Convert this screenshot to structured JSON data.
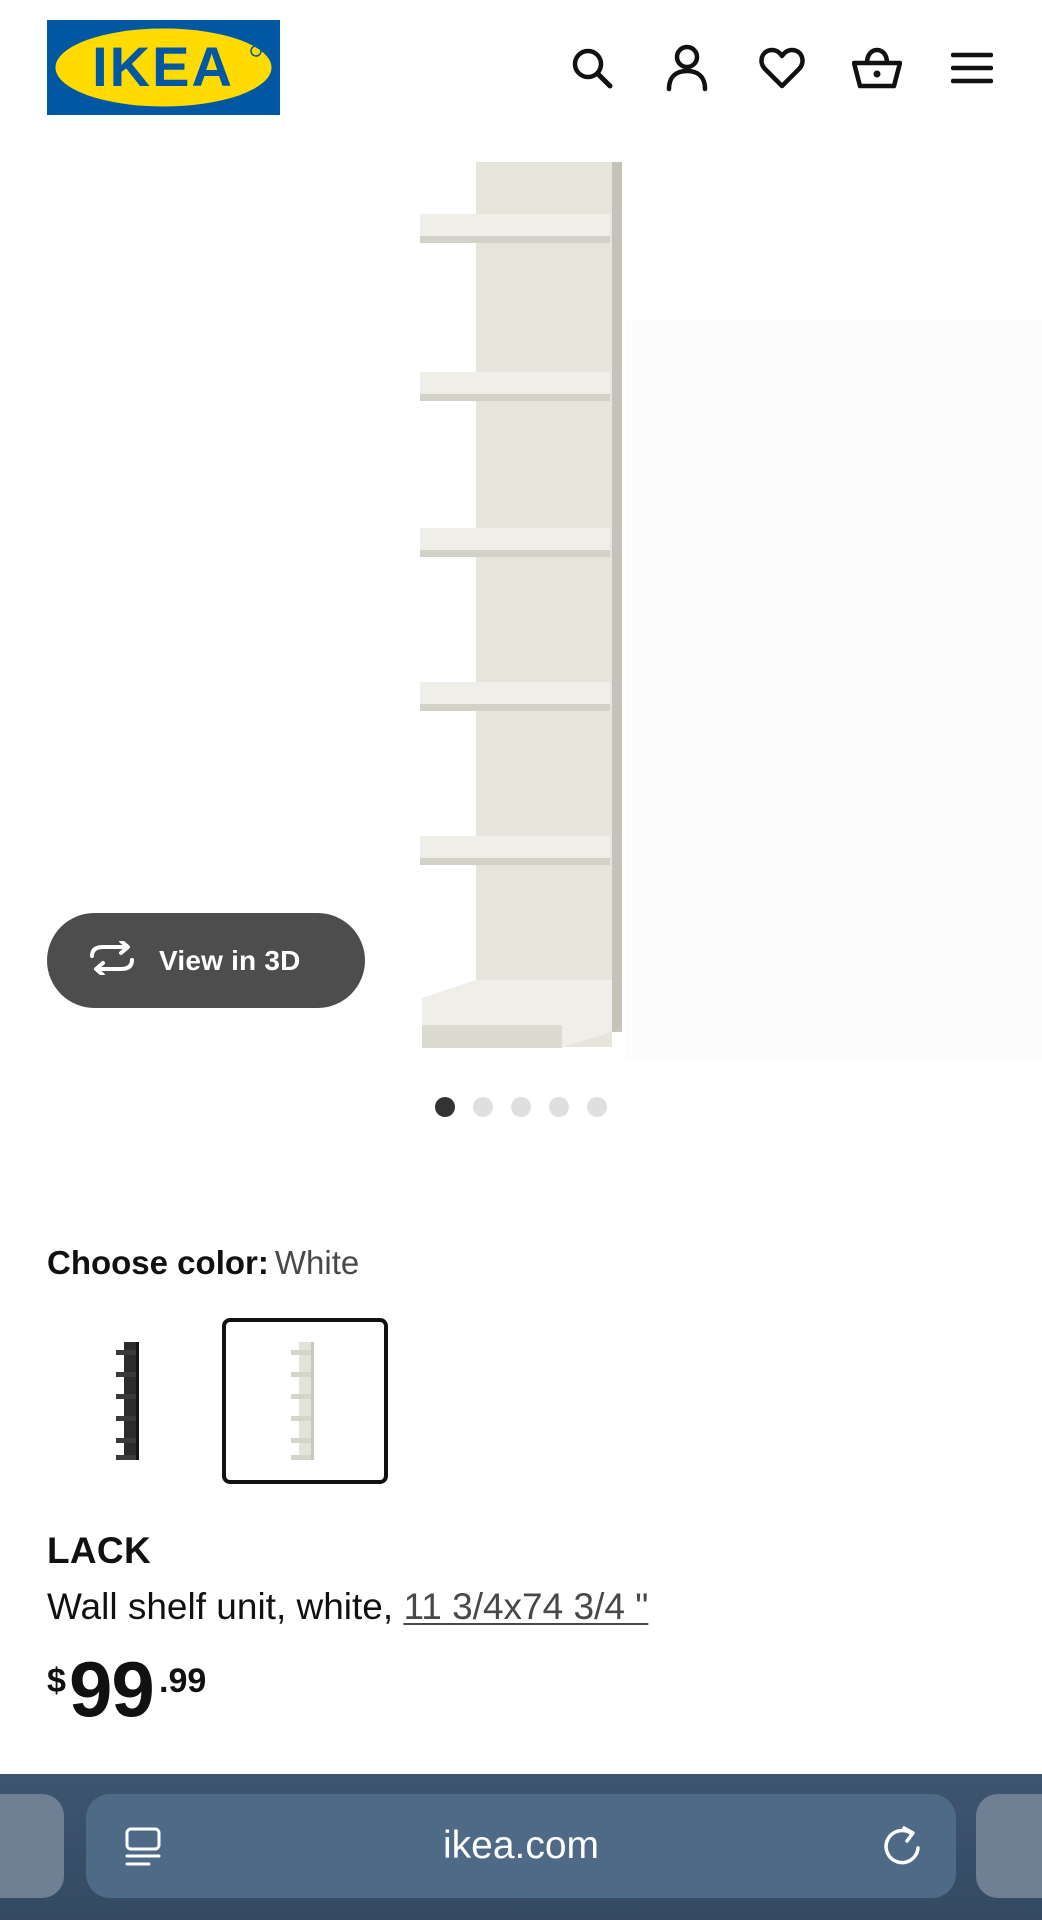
{
  "header": {
    "logo_text": "IKEA",
    "colors": {
      "logo_blue": "#0058a3",
      "logo_yellow": "#ffdb00"
    },
    "icons": [
      "search-icon",
      "account-icon",
      "heart-icon",
      "basket-icon",
      "menu-icon"
    ]
  },
  "gallery": {
    "view_3d_label": "View in 3D",
    "view_3d_icon": "rotate-3d-icon",
    "dot_count": 5,
    "active_dot": 1
  },
  "color_choice": {
    "label": "Choose color:",
    "value": "White",
    "options": [
      {
        "name": "black-brown",
        "selected": false
      },
      {
        "name": "white",
        "selected": true
      }
    ]
  },
  "product": {
    "name": "LACK",
    "description": "Wall shelf unit, white,",
    "dimensions": "11 3/4x74 3/4 \"",
    "price": {
      "currency": "$",
      "integer": "99",
      "decimal": ".99"
    }
  },
  "browser": {
    "url": "ikea.com",
    "left_icon": "reader-icon",
    "right_icon": "reload-icon",
    "colors": {
      "bar": "#3e5570",
      "field": "#4f6a87"
    }
  }
}
